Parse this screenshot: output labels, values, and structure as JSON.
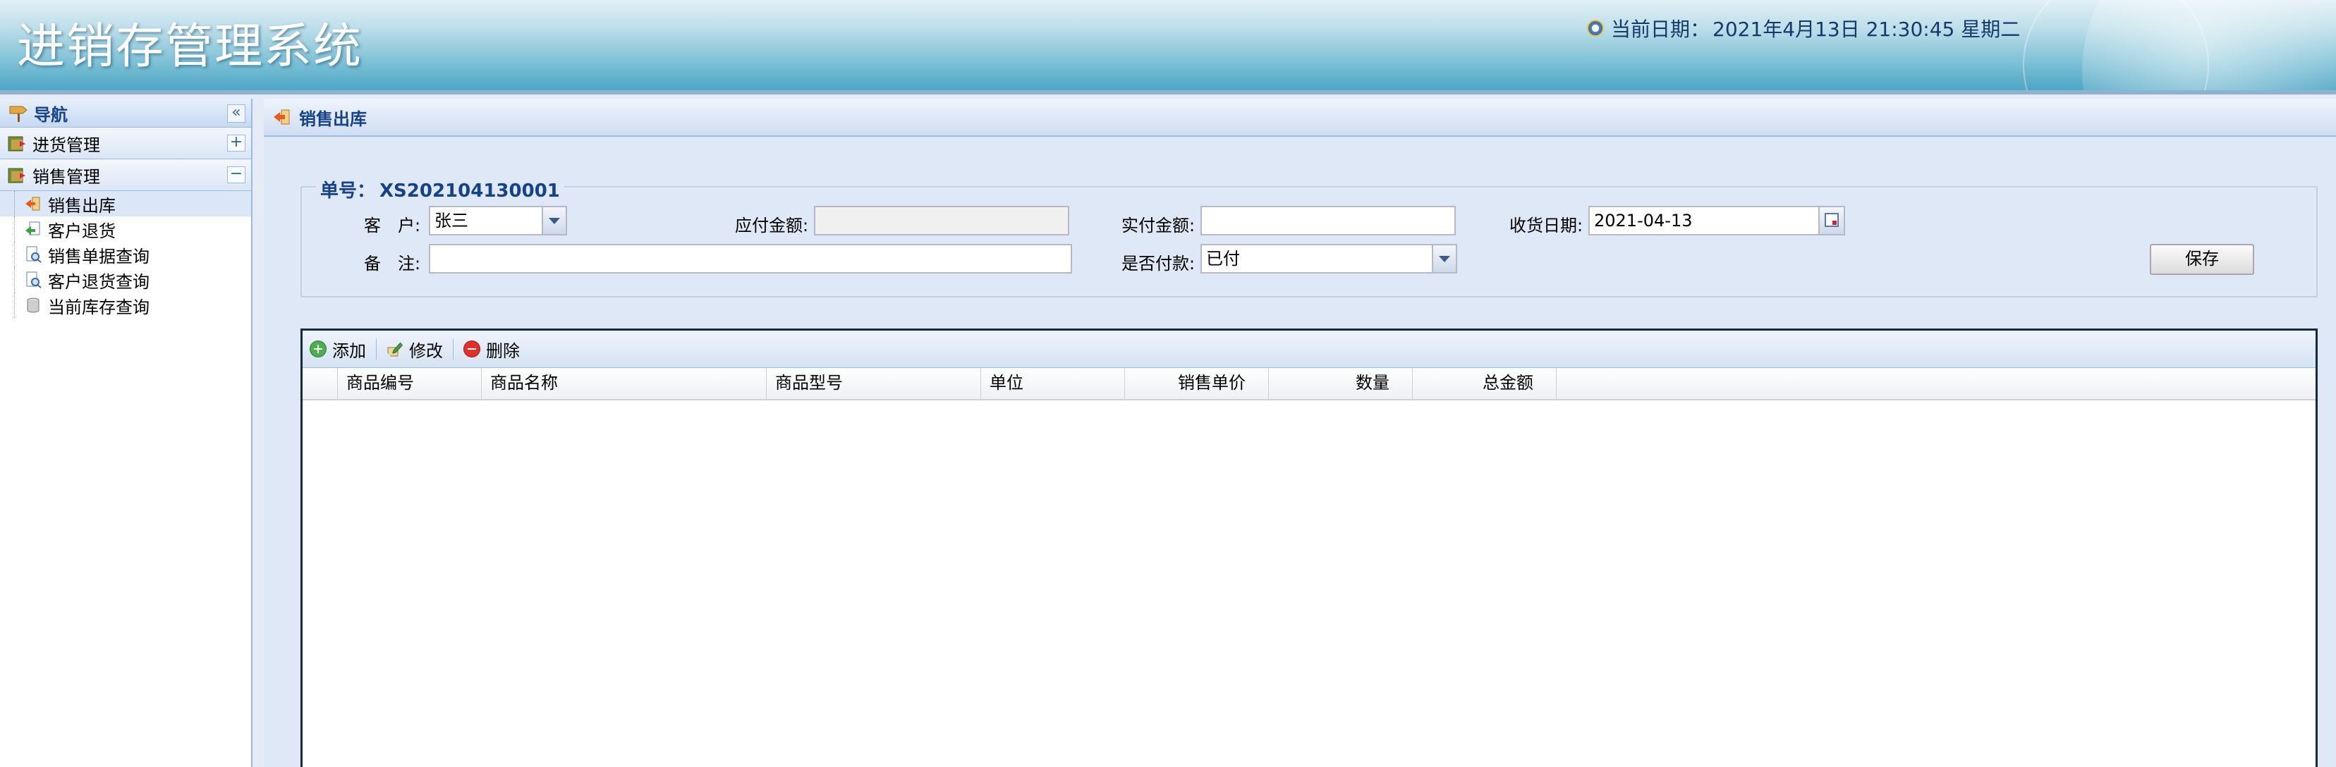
{
  "header": {
    "app_title": "进销存管理系统",
    "date_label": "当前日期：",
    "date_value": "2021年4月13日 21:30:45 星期二"
  },
  "nav": {
    "title": "导航",
    "collapse_symbol": "«",
    "groups": [
      {
        "label": "进货管理",
        "toggle": "+",
        "expanded": false
      },
      {
        "label": "销售管理",
        "toggle": "−",
        "expanded": true,
        "items": [
          {
            "label": "销售出库",
            "icon": "exit-arrow-icon",
            "selected": true
          },
          {
            "label": "客户退货",
            "icon": "return-doc-icon",
            "selected": false
          },
          {
            "label": "销售单据查询",
            "icon": "search-doc-icon",
            "selected": false
          },
          {
            "label": "客户退货查询",
            "icon": "search-doc-icon",
            "selected": false
          },
          {
            "label": "当前库存查询",
            "icon": "database-icon",
            "selected": false
          }
        ]
      }
    ]
  },
  "panel": {
    "title": "销售出库",
    "order_label": "单号：",
    "order_number": "XS202104130001",
    "form": {
      "customer_label": "客　户:",
      "customer_value": "张三",
      "payable_label": "应付金额:",
      "payable_value": "",
      "paid_label": "实付金额:",
      "paid_value": "",
      "receive_date_label": "收货日期:",
      "receive_date_value": "2021-04-13",
      "remark_label": "备　注:",
      "remark_value": "",
      "is_paid_label": "是否付款:",
      "is_paid_value": "已付",
      "save_label": "保存"
    },
    "toolbar": {
      "add_label": "添加",
      "edit_label": "修改",
      "delete_label": "删除"
    },
    "grid_columns": [
      "商品编号",
      "商品名称",
      "商品型号",
      "单位",
      "销售单价",
      "数量",
      "总金额"
    ],
    "grid_rows": []
  },
  "colors": {
    "accent": "#15428b",
    "border": "#99bbe8",
    "panel_bg": "#dfe8f6"
  }
}
